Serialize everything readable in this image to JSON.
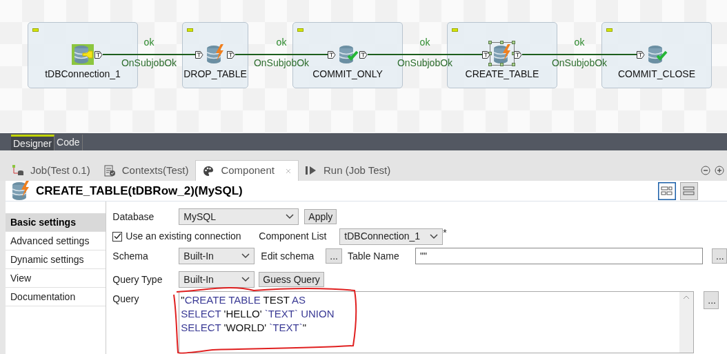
{
  "designer": {
    "nodes": [
      {
        "label": "tDBConnection_1",
        "kind": "connection",
        "selected": false
      },
      {
        "label": "DROP_TABLE",
        "kind": "row",
        "selected": false
      },
      {
        "label": "COMMIT_ONLY",
        "kind": "commit",
        "selected": false
      },
      {
        "label": "CREATE_TABLE",
        "kind": "row",
        "selected": true
      },
      {
        "label": "COMMIT_CLOSE",
        "kind": "commit",
        "selected": false
      }
    ],
    "links": [
      {
        "top": "ok",
        "bottom": "OnSubjobOk"
      },
      {
        "top": "ok",
        "bottom": "OnSubjobOk"
      },
      {
        "top": "ok",
        "bottom": "OnSubjobOk"
      },
      {
        "top": "ok",
        "bottom": "OnSubjobOk"
      }
    ]
  },
  "editor_tabs": [
    {
      "label": "Designer",
      "selected": true
    },
    {
      "label": "Code",
      "selected": false
    }
  ],
  "view_tabs": [
    {
      "label": "Job(Test 0.1)",
      "kind": "job",
      "selected": false
    },
    {
      "label": "Contexts(Test)",
      "kind": "contexts",
      "selected": false
    },
    {
      "label": "Component",
      "kind": "component",
      "selected": true
    },
    {
      "label": "Run (Job Test)",
      "kind": "run",
      "selected": false
    }
  ],
  "component_title": "CREATE_TABLE(tDBRow_2)(MySQL)",
  "sidebar": {
    "items": [
      {
        "label": "Basic settings",
        "selected": true
      },
      {
        "label": "Advanced settings",
        "selected": false
      },
      {
        "label": "Dynamic settings",
        "selected": false
      },
      {
        "label": "View",
        "selected": false
      },
      {
        "label": "Documentation",
        "selected": false
      }
    ]
  },
  "form": {
    "database": {
      "label": "Database",
      "value": "MySQL",
      "button": "Apply"
    },
    "use_existing_connection": {
      "label": "Use an existing connection",
      "checked": true
    },
    "component_list": {
      "label": "Component List",
      "value": "tDBConnection_1",
      "marker": "*"
    },
    "schema": {
      "label": "Schema",
      "value": "Built-In",
      "edit_label": "Edit schema",
      "edit_button": "..."
    },
    "table_name": {
      "label": "Table Name",
      "value": "\"\"",
      "button": "..."
    },
    "query_type": {
      "label": "Query Type",
      "value": "Built-In",
      "button": "Guess Query"
    },
    "query": {
      "label": "Query",
      "button": "...",
      "lines": [
        [
          {
            "text": "\"",
            "kind": "string"
          },
          {
            "text": "CREATE TABLE",
            "kind": "keyword"
          },
          {
            "text": " TEST ",
            "kind": "string"
          },
          {
            "text": "AS",
            "kind": "keyword"
          }
        ],
        [
          {
            "text": "SELECT",
            "kind": "keyword"
          },
          {
            "text": " 'HELLO' ",
            "kind": "string"
          },
          {
            "text": "`TEXT`",
            "kind": "keyword"
          },
          {
            "text": " UNION",
            "kind": "keyword"
          }
        ],
        [
          {
            "text": "SELECT",
            "kind": "keyword"
          },
          {
            "text": " 'WORLD' ",
            "kind": "string"
          },
          {
            "text": "`TEXT`",
            "kind": "keyword"
          },
          {
            "text": "\"",
            "kind": "string"
          }
        ]
      ]
    }
  }
}
